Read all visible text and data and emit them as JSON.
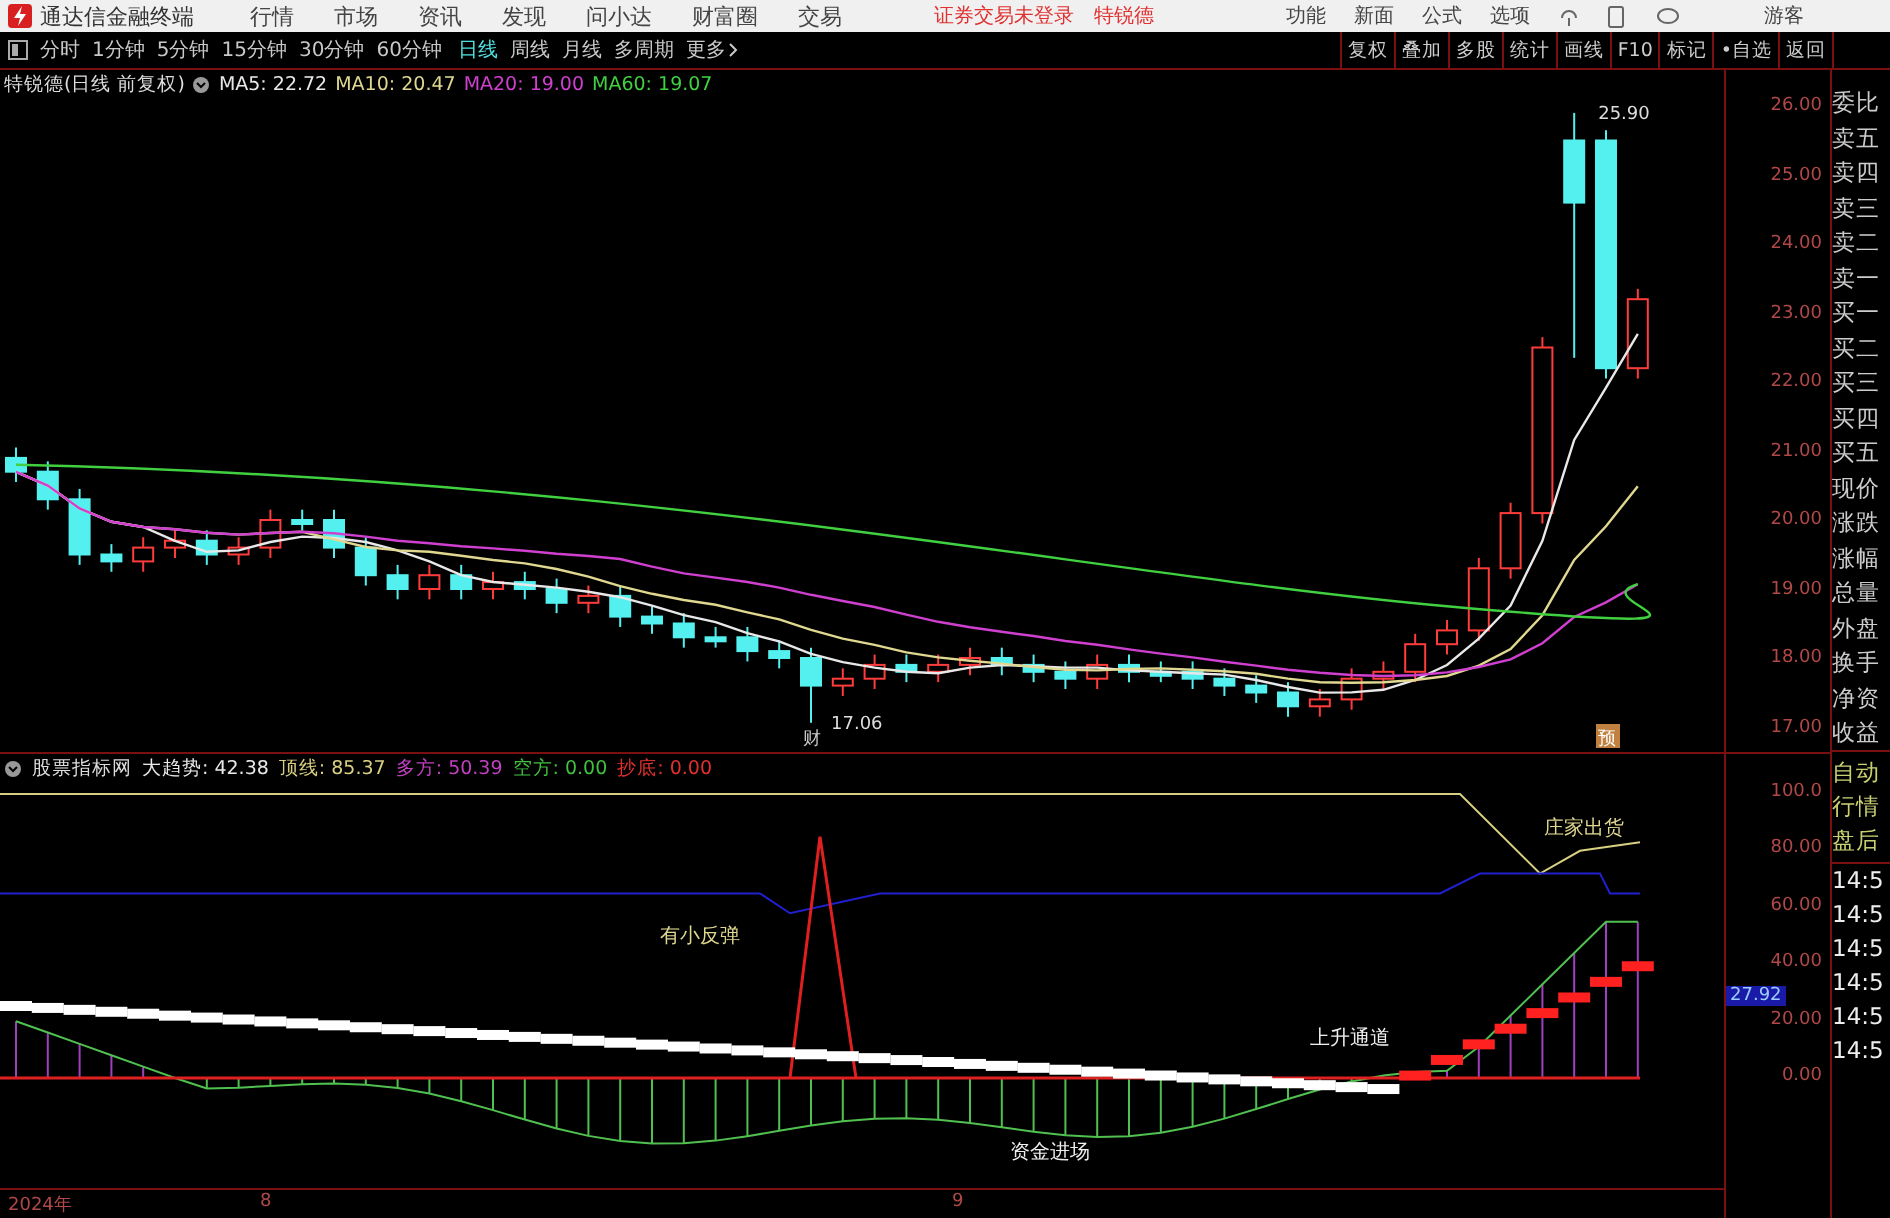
{
  "title_bar": {
    "app_name": "通达信金融终端",
    "menu": [
      "行情",
      "市场",
      "资讯",
      "发现",
      "问小达",
      "财富圈",
      "交易"
    ],
    "notice": "证券交易未登录",
    "stock_name": "特锐德",
    "actions": [
      "功能",
      "新面",
      "公式",
      "选项"
    ],
    "user": "游客"
  },
  "period_tabs": [
    {
      "label": "分时",
      "selected": false
    },
    {
      "label": "1分钟",
      "selected": false
    },
    {
      "label": "5分钟",
      "selected": false
    },
    {
      "label": "15分钟",
      "selected": false
    },
    {
      "label": "30分钟",
      "selected": false
    },
    {
      "label": "60分钟",
      "selected": false
    },
    {
      "label": "日线",
      "selected": true
    },
    {
      "label": "周线",
      "selected": false
    },
    {
      "label": "月线",
      "selected": false
    },
    {
      "label": "多周期",
      "selected": false
    },
    {
      "label": "更多",
      "selected": false
    }
  ],
  "tools": [
    "复权",
    "叠加",
    "多股",
    "统计",
    "画线",
    "F10",
    "标记",
    "•自选",
    "返回"
  ],
  "main_chart": {
    "caption": "特锐德(日线 前复权)",
    "ma": [
      {
        "label": "MA5: 22.72",
        "color": "#e8e8e8"
      },
      {
        "label": "MA10: 20.47",
        "color": "#e0d890"
      },
      {
        "label": "MA20: 19.00",
        "color": "#d040d0"
      },
      {
        "label": "MA60: 19.07",
        "color": "#40d040"
      }
    ],
    "price_labels": [
      "26.00",
      "25.00",
      "24.00",
      "23.00",
      "22.00",
      "21.00",
      "20.00",
      "19.00",
      "18.00",
      "17.00"
    ],
    "high_label": "25.90",
    "low_label": "17.06",
    "markers": [
      "财",
      "预"
    ]
  },
  "quote_panel": [
    "委比",
    "卖五",
    "卖四",
    "卖三",
    "卖二",
    "卖一",
    "买一",
    "买二",
    "买三",
    "买四",
    "买五",
    "现价",
    "涨跌",
    "涨幅",
    "总量",
    "外盘",
    "换手",
    "净资",
    "收益"
  ],
  "indicator": {
    "name": "股票指标网",
    "values": [
      {
        "label": "大趋势: 42.38",
        "color": "#e8e8e8"
      },
      {
        "label": "顶线: 85.37",
        "color": "#d8d080"
      },
      {
        "label": "多方: 50.39",
        "color": "#c040c0"
      },
      {
        "label": "空方: 0.00",
        "color": "#40c040"
      },
      {
        "label": "抄底: 0.00",
        "color": "#e03030"
      }
    ],
    "axis_labels": [
      "100.0",
      "80.00",
      "60.00",
      "40.00",
      "20.00",
      "0.00"
    ],
    "current": "27.92",
    "signals": [
      "有小反弹",
      "庄家出货",
      "上升通道",
      "资金进场"
    ]
  },
  "side_panel": {
    "modes": [
      "自动",
      "行情",
      "盘后"
    ],
    "times": [
      "14:5",
      "14:5",
      "14:5",
      "14:5",
      "14:5",
      "14:5"
    ]
  },
  "date_axis": [
    "2024年",
    "8",
    "9"
  ]
}
